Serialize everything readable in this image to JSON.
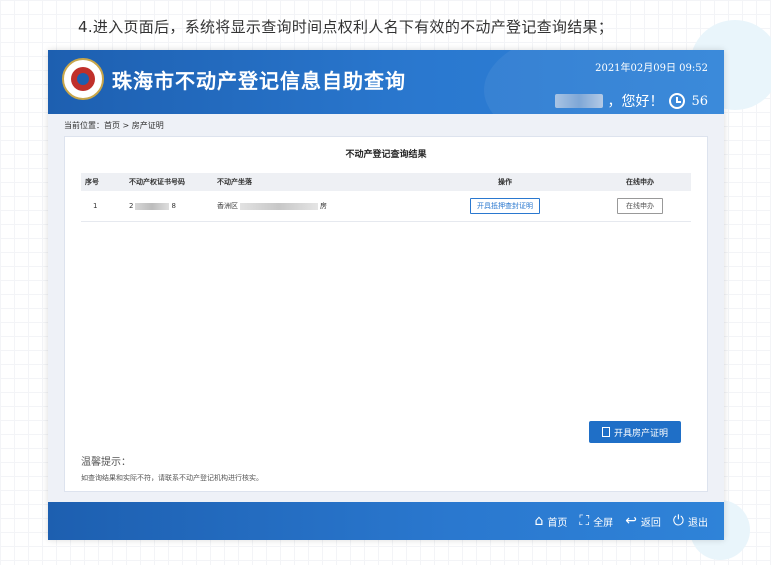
{
  "caption": "4.进入页面后，系统将显示查询时间点权利人名下有效的不动产登记查询结果；",
  "header": {
    "title": "珠海市不动产登记信息自助查询",
    "datetime": "2021年02月09日 09:52",
    "greeting": "，您好！",
    "countdown": "56"
  },
  "breadcrumb": "当前位置：首页 > 房产证明",
  "panel": {
    "title": "不动产登记查询结果",
    "columns": [
      "序号",
      "不动产权证书号码",
      "不动产坐落",
      "操作",
      "在线申办"
    ],
    "rows": [
      {
        "index": "1",
        "cert_prefix": "2",
        "cert_suffix": "8",
        "location_prefix": "香洲区",
        "location_suffix": "房",
        "action": "开具抵押查封证明",
        "online": "在线申办"
      }
    ],
    "house_button": "开具房产证明",
    "tips_title": "温馨提示：",
    "tips_text": "如查询结果和实际不符，请联系不动产登记机构进行核实。"
  },
  "footer": {
    "home": "首页",
    "fullscreen": "全屏",
    "back": "返回",
    "exit": "退出"
  },
  "colors": {
    "header_blue": "#1d5fb0",
    "accent_blue": "#2a78cf",
    "panel_bg": "#eef1f7"
  }
}
